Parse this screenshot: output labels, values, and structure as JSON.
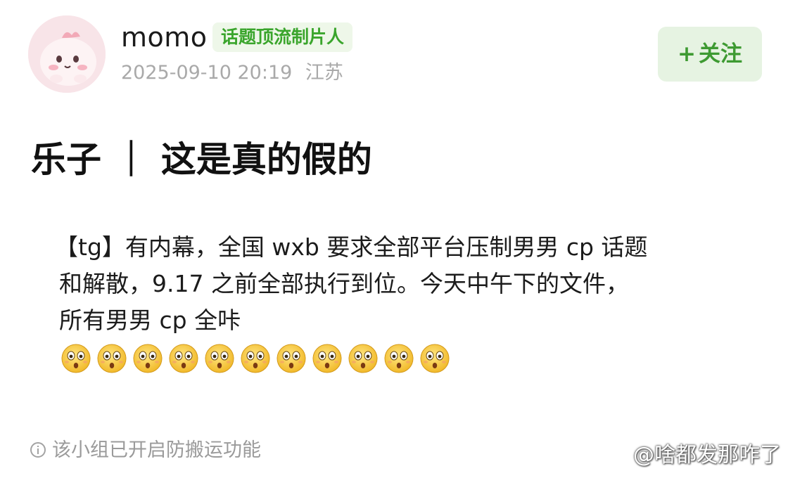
{
  "header": {
    "username": "momo",
    "badge": "话题顶流制片人",
    "timestamp": "2025-09-10 20:19",
    "location": "江苏",
    "follow_label": "关注",
    "follow_prefix": "+",
    "avatar_icon": "cute-pink-character-avatar"
  },
  "post": {
    "title": "乐子 ｜ 这是真的假的",
    "body_lines": [
      "【tg】有内幕，全国 wxb 要求全部平台压制男男 cp 话题",
      "和解散，9.17 之前全部执行到位。今天中午下的文件，",
      "所有男男 cp 全咔"
    ],
    "emoji_name": "shocked-face-emoji",
    "emoji_count": 11
  },
  "footer": {
    "notice": "该小组已开启防搬运功能",
    "notice_icon": "info-circle-icon",
    "watermark": "@啥都发那咋了",
    "watermark_icon": "weibo-eye-icon"
  },
  "colors": {
    "badge_text": "#3aa52c",
    "badge_bg": "#eef7e9",
    "follow_bg": "#e6f3e2",
    "follow_text": "#3e9a32",
    "meta_text": "#a9a9a9"
  }
}
